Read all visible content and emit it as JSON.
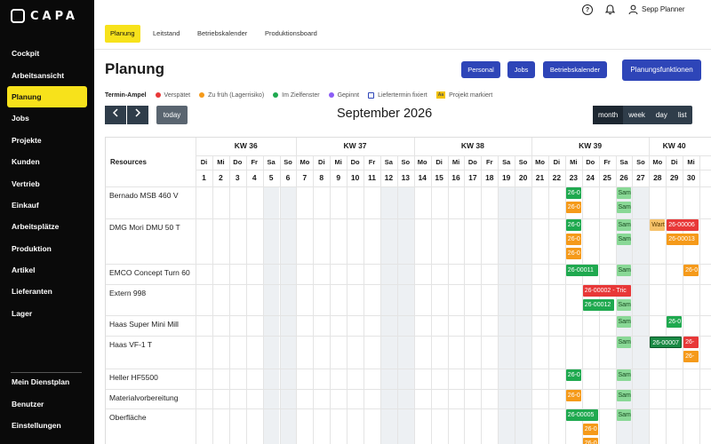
{
  "app": {
    "logo": "CAPA"
  },
  "sidebar": {
    "items": [
      "Cockpit",
      "Arbeitsansicht",
      "Planung",
      "Jobs",
      "Projekte",
      "Kunden",
      "Vertrieb",
      "Einkauf",
      "Arbeitsplätze",
      "Produktion",
      "Artikel",
      "Lieferanten",
      "Lager"
    ],
    "active": "Planung",
    "bottom": [
      "Mein Dienstplan",
      "Benutzer",
      "Einstellungen"
    ]
  },
  "topbar": {
    "user": "Sepp Planner"
  },
  "tabs": [
    "Planung",
    "Leitstand",
    "Betriebskalender",
    "Produktionsboard"
  ],
  "page": {
    "title": "Planung",
    "buttons": [
      "Personal",
      "Jobs",
      "Betriebskalender"
    ],
    "primary_button": "Planungsfunktionen"
  },
  "legend": {
    "label": "Termin-Ampel",
    "items": [
      {
        "text": "Verspätet",
        "color": "#e83838"
      },
      {
        "text": "Zu früh (Lagerrisiko)",
        "color": "#f59a1a"
      },
      {
        "text": "Im Zielfenster",
        "color": "#1fa94f"
      },
      {
        "text": "Gepinnt",
        "color": "#8b5cf6"
      },
      {
        "text": "Liefertermin fixiert",
        "color": "#2e45b8"
      },
      {
        "text": "Projekt markiert",
        "color": "#f2c200",
        "tag": "Aa"
      }
    ]
  },
  "calendar": {
    "today_label": "today",
    "month_title": "September 2026",
    "views": [
      "month",
      "week",
      "day",
      "list"
    ],
    "active_view": "month",
    "resources_header": "Resources",
    "weeks": [
      "KW 36",
      "KW 37",
      "KW 38",
      "KW 39",
      "KW 40"
    ],
    "days": [
      {
        "d": "Di",
        "n": "1"
      },
      {
        "d": "Mi",
        "n": "2"
      },
      {
        "d": "Do",
        "n": "3"
      },
      {
        "d": "Fr",
        "n": "4"
      },
      {
        "d": "Sa",
        "n": "5"
      },
      {
        "d": "So",
        "n": "6"
      },
      {
        "d": "Mo",
        "n": "7"
      },
      {
        "d": "Di",
        "n": "8"
      },
      {
        "d": "Mi",
        "n": "9"
      },
      {
        "d": "Do",
        "n": "10"
      },
      {
        "d": "Fr",
        "n": "11"
      },
      {
        "d": "Sa",
        "n": "12"
      },
      {
        "d": "So",
        "n": "13"
      },
      {
        "d": "Mo",
        "n": "14"
      },
      {
        "d": "Di",
        "n": "15"
      },
      {
        "d": "Mi",
        "n": "16"
      },
      {
        "d": "Do",
        "n": "17"
      },
      {
        "d": "Fr",
        "n": "18"
      },
      {
        "d": "Sa",
        "n": "19"
      },
      {
        "d": "So",
        "n": "20"
      },
      {
        "d": "Mo",
        "n": "21"
      },
      {
        "d": "Di",
        "n": "22"
      },
      {
        "d": "Mi",
        "n": "23"
      },
      {
        "d": "Do",
        "n": "24"
      },
      {
        "d": "Fr",
        "n": "25"
      },
      {
        "d": "Sa",
        "n": "26"
      },
      {
        "d": "So",
        "n": "27"
      },
      {
        "d": "Mo",
        "n": "28"
      },
      {
        "d": "Di",
        "n": "29"
      },
      {
        "d": "Mi",
        "n": "30"
      }
    ],
    "resources": [
      "Bernado MSB 460 V",
      "DMG Mori DMU 50 T",
      "EMCO Concept Turn 60",
      "Extern 998",
      "Haas Super Mini Mill",
      "Haas VF-1 T",
      "Heller HF5500",
      "Materialvorbereitung",
      "Oberfläche"
    ],
    "events": [
      {
        "row": 0,
        "line": 0,
        "day": 23,
        "span": 1,
        "color": "green",
        "text": "26-0"
      },
      {
        "row": 0,
        "line": 1,
        "day": 23,
        "span": 1,
        "color": "orange",
        "text": "26-0"
      },
      {
        "row": 0,
        "line": 0,
        "day": 26,
        "span": 1,
        "color": "lgreen",
        "text": "Sam"
      },
      {
        "row": 0,
        "line": 1,
        "day": 26,
        "span": 1,
        "color": "lgreen",
        "text": "Sam"
      },
      {
        "row": 1,
        "line": 0,
        "day": 23,
        "span": 1,
        "color": "green",
        "text": "26-0"
      },
      {
        "row": 1,
        "line": 1,
        "day": 23,
        "span": 1,
        "color": "orange",
        "text": "26-0"
      },
      {
        "row": 1,
        "line": 2,
        "day": 23,
        "span": 1,
        "color": "orange",
        "text": "26-0"
      },
      {
        "row": 1,
        "line": 0,
        "day": 26,
        "span": 1,
        "color": "lgreen",
        "text": "Sam"
      },
      {
        "row": 1,
        "line": 1,
        "day": 26,
        "span": 1,
        "color": "lgreen",
        "text": "Sam"
      },
      {
        "row": 1,
        "line": 0,
        "day": 28,
        "span": 1,
        "color": "lorange",
        "text": "Wart"
      },
      {
        "row": 1,
        "line": 0,
        "day": 29,
        "span": 2,
        "color": "red",
        "text": "26-00006"
      },
      {
        "row": 1,
        "line": 1,
        "day": 29,
        "span": 2,
        "color": "orange",
        "text": "26-00013"
      },
      {
        "row": 2,
        "line": 0,
        "day": 23,
        "span": 2,
        "color": "green",
        "text": "26-00011"
      },
      {
        "row": 2,
        "line": 0,
        "day": 26,
        "span": 1,
        "color": "lgreen",
        "text": "Sam"
      },
      {
        "row": 2,
        "line": 0,
        "day": 30,
        "span": 1,
        "color": "orange",
        "text": "26-0"
      },
      {
        "row": 3,
        "line": 0,
        "day": 24,
        "span": 3,
        "color": "red",
        "text": "26-00002 - Tric"
      },
      {
        "row": 3,
        "line": 1,
        "day": 24,
        "span": 2,
        "color": "green",
        "text": "26-00012"
      },
      {
        "row": 3,
        "line": 1,
        "day": 26,
        "span": 1,
        "color": "lgreen",
        "text": "Sam"
      },
      {
        "row": 4,
        "line": 0,
        "day": 26,
        "span": 1,
        "color": "lgreen",
        "text": "Sam"
      },
      {
        "row": 4,
        "line": 0,
        "day": 29,
        "span": 1,
        "color": "green",
        "text": "26-0"
      },
      {
        "row": 5,
        "line": 0,
        "day": 26,
        "span": 1,
        "color": "lgreen",
        "text": "Sam"
      },
      {
        "row": 5,
        "line": 0,
        "day": 28,
        "span": 2,
        "color": "dark",
        "text": "26-00007"
      },
      {
        "row": 5,
        "line": 0,
        "day": 30,
        "span": 1,
        "color": "red",
        "text": "26-"
      },
      {
        "row": 5,
        "line": 1,
        "day": 30,
        "span": 1,
        "color": "orange",
        "text": "26-"
      },
      {
        "row": 6,
        "line": 0,
        "day": 23,
        "span": 1,
        "color": "green",
        "text": "26-0"
      },
      {
        "row": 6,
        "line": 0,
        "day": 26,
        "span": 1,
        "color": "lgreen",
        "text": "Sam"
      },
      {
        "row": 7,
        "line": 0,
        "day": 23,
        "span": 1,
        "color": "orange",
        "text": "26-0"
      },
      {
        "row": 7,
        "line": 0,
        "day": 26,
        "span": 1,
        "color": "lgreen",
        "text": "Sam"
      },
      {
        "row": 8,
        "line": 0,
        "day": 23,
        "span": 2,
        "color": "green",
        "text": "26-00005"
      },
      {
        "row": 8,
        "line": 0,
        "day": 26,
        "span": 1,
        "color": "lgreen",
        "text": "Sam"
      },
      {
        "row": 8,
        "line": 1,
        "day": 24,
        "span": 1,
        "color": "orange",
        "text": "26-0"
      },
      {
        "row": 8,
        "line": 2,
        "day": 24,
        "span": 1,
        "color": "orange",
        "text": "26-0"
      }
    ]
  }
}
